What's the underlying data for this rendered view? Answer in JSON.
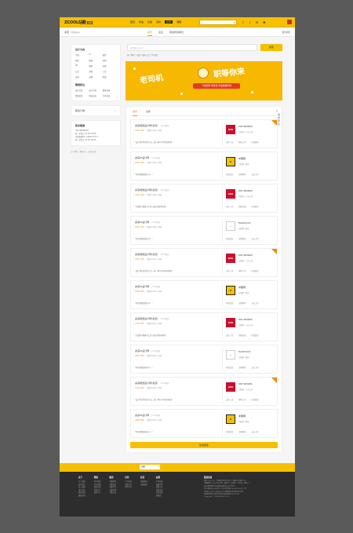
{
  "topbar": {
    "logo": "ZCOOL站酷",
    "logo_badge": "招聘",
    "nav": [
      "首页",
      "作品",
      "文章",
      "活动",
      "招聘",
      "课程"
    ],
    "active_nav": "招聘",
    "icons": [
      "search-icon",
      "upload-icon",
      "bell-icon",
      "mail-icon",
      "gear-icon"
    ]
  },
  "subbar": {
    "city": "北京",
    "city_hint": "[切换城市]",
    "tabs": [
      "首页",
      "企业",
      "我发布的职位"
    ],
    "right": "我的简历"
  },
  "sidebar": {
    "design_title": "设计方向",
    "design_items": [
      "平面",
      "UI",
      "视觉",
      "网页",
      "插画",
      "动画",
      "3D",
      "摄影",
      "其他",
      "交互",
      "游戏",
      "工业",
      "运营",
      "品牌",
      "影视"
    ],
    "manage_title": "管理职位",
    "manage_items": [
      "设计总监",
      "设计主管",
      "视觉总监",
      "策划总监",
      "创意总监",
      "艺术总监"
    ],
    "job_title": "职位订阅",
    "job_arrow": "→",
    "contact_title": "联系客服",
    "contact_lines": [
      "010-68608630",
      "周一至周五 10:00-18:00",
      "在线客服QQ: 2880471571",
      "周一至周五 10:00-18:00"
    ],
    "foot": "关于我们 · 帮助中心 · 意见反馈"
  },
  "main": {
    "search_placeholder": "搜索职位或公司",
    "search_button": "搜索",
    "hotwords": "热门搜索: UI设计  插画  交互  3D  视觉",
    "banner": {
      "left": "老司机",
      "right": "职等你来",
      "ribbon": "飞机招聘 年终奖 年底跳槽专场"
    },
    "tabs": [
      "推荐",
      "最新"
    ],
    "publish": "发布职位",
    "jobs": [
      {
        "title": "资深视觉设计师(北京)",
        "time": "11:35发布",
        "salary": "15k-30k",
        "req": "经验5-10年 / 本科",
        "quote": "\"设计我们喜欢的产品，做一种与众不同的体验\"",
        "company": "UID WORKS",
        "meta": "互联网 / 上市公司",
        "logo": "UID",
        "logo_type": "uid",
        "tags": [
          "五险一金",
          "弹性工作",
          "年终奖金"
        ],
        "corner": true
      },
      {
        "title": "资深UI设计师",
        "time": "11:35发布",
        "salary": "20k-25k",
        "req": "经验5-10年 / 本科",
        "quote": "\"你的理想是做什么？\"",
        "company": "中童网",
        "meta": "互联网 / 移动",
        "logo": "Z",
        "logo_type": "zk",
        "tags": [
          "年终奖金",
          "定期体检",
          "五天工作"
        ],
        "corner": false
      },
      {
        "title": "资深视觉设计师(北京)",
        "time": "11:35发布",
        "salary": "15k-30k",
        "req": "经验5-10年 / 本科",
        "quote": "\"互联网+健康+生活+成功的服务体验\"",
        "company": "UID WORKS",
        "meta": "互联网 / 上市公司",
        "logo": "UID",
        "logo_type": "uid",
        "tags": [
          "五险一金",
          "团队和谐",
          "年终奖金"
        ],
        "corner": false
      },
      {
        "title": "资深UI设计师",
        "time": "11:35发布",
        "salary": "20k-25k",
        "req": "经验5-10年 / 本科",
        "quote": "\"你的理想是做什么？\"",
        "company": "Earth2113",
        "meta": "互联网 / 移动",
        "logo": "~",
        "logo_type": "earth",
        "tags": [
          "年终奖金",
          "定期体检",
          "五天工作"
        ],
        "corner": false
      },
      {
        "title": "资深视觉设计师(北京)",
        "time": "11:35发布",
        "salary": "15k-30k",
        "req": "经验5-10年 / 本科",
        "quote": "\"设计我们喜欢的产品，做一种与众不同的体验\"",
        "company": "UID WORKS",
        "meta": "互联网 / 上市公司",
        "logo": "UID",
        "logo_type": "uid",
        "tags": [
          "五险一金",
          "弹性工作",
          "年终奖金"
        ],
        "corner": true
      },
      {
        "title": "资深UI设计师",
        "time": "11:35发布",
        "salary": "20k-25k",
        "req": "经验5-10年 / 本科",
        "quote": "\"你的理想是做什么？\"",
        "company": "中童网",
        "meta": "互联网 / 移动",
        "logo": "Z",
        "logo_type": "zk",
        "tags": [
          "年终奖金",
          "定期体检",
          "五天工作"
        ],
        "corner": false
      },
      {
        "title": "资深视觉设计师(北京)",
        "time": "11:35发布",
        "salary": "15k-30k",
        "req": "经验5-10年 / 本科",
        "quote": "\"互联网+健康+生活+成功的服务体验\"",
        "company": "UID WORKS",
        "meta": "互联网 / 上市公司",
        "logo": "UID",
        "logo_type": "uid",
        "tags": [
          "五险一金",
          "团队和谐",
          "年终奖金"
        ],
        "corner": false
      },
      {
        "title": "资深UI设计师",
        "time": "11:35发布",
        "salary": "20k-25k",
        "req": "经验5-10年 / 本科",
        "quote": "\"你的理想是做什么？\"",
        "company": "Earth2113",
        "meta": "互联网 / 移动",
        "logo": "~",
        "logo_type": "earth",
        "tags": [
          "年终奖金",
          "定期体检",
          "五天工作"
        ],
        "corner": false
      },
      {
        "title": "资深视觉设计师(北京)",
        "time": "11:35发布",
        "salary": "15k-30k",
        "req": "经验5-10年 / 本科",
        "quote": "\"设计我们喜欢的产品，做一种与众不同的体验\"",
        "company": "UID WORKS",
        "meta": "互联网 / 上市公司",
        "logo": "UID",
        "logo_type": "uid",
        "tags": [
          "五险一金",
          "弹性工作",
          "年终奖金"
        ],
        "corner": true
      },
      {
        "title": "资深UI设计师",
        "time": "11:35发布",
        "salary": "20k-25k",
        "req": "经验5-10年 / 本科",
        "quote": "\"你的理想是做什么？\"",
        "company": "中童网",
        "meta": "互联网 / 移动",
        "logo": "Z",
        "logo_type": "zk",
        "tags": [
          "年终奖金",
          "定期体检",
          "五天工作"
        ],
        "corner": false
      }
    ],
    "more_button": "加载更多"
  },
  "footer": {
    "select": "站酷",
    "cols": [
      {
        "title": "关于",
        "items": [
          "关于站酷",
          "联系我们",
          "加入站酷",
          "用户协议",
          "隐私政策",
          "版权说明"
        ]
      },
      {
        "title": "帮助",
        "items": [
          "新手指南",
          "常见问题",
          "意见反馈",
          "举报中心",
          "帮助中心"
        ]
      },
      {
        "title": "服务",
        "items": [
          "站酷推荐",
          "站酷海洛",
          "站酷学习",
          "站酷招聘",
          "站酷公益"
        ]
      },
      {
        "title": "合作",
        "items": [
          "广告投放",
          "品牌合作",
          "商务合作"
        ]
      },
      {
        "title": "社区",
        "items": [
          "站酷移动",
          "站酷微博"
        ]
      },
      {
        "title": "友情",
        "items": [
          "手机站酷",
          "站酷APP",
          "站酷大学",
          "站酷文库",
          "海洛创意",
          "站酷奖"
        ]
      }
    ],
    "right_title": "版权信息",
    "right_lines": [
      "站酷 (ZCOOL)，中国设计师互动平台。深耕设计领域十年，",
      "站酷聚集了1200万设计师、摄影师、插画师、艺术家、创意人，",
      "设计创意群体中具有较高的影响力与号召力。",
      "京ICP备08102442号-1 京公网安备11010502030377号",
      "京网文 (2017) 4305-377号 增值电信业务经营许可证",
      "出版物经营许可证 新出发京批字第直1601014号",
      "Copyright © 2006-2018 ZCOOL"
    ]
  }
}
